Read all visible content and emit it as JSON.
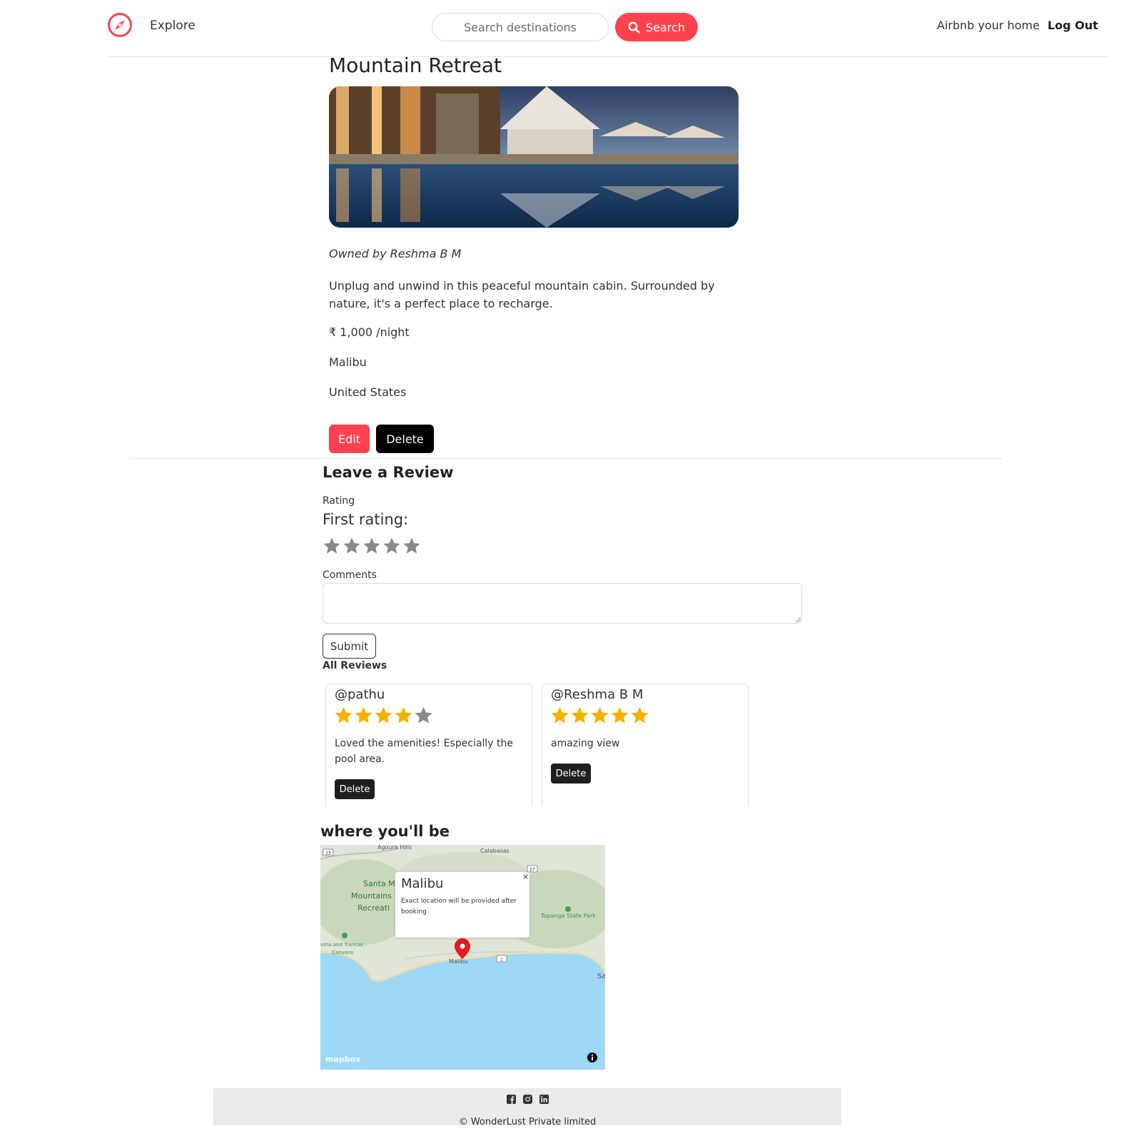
{
  "nav": {
    "explore_label": "Explore",
    "search_placeholder": "Search destinations",
    "search_button": "Search",
    "airbnb_label": "Airbnb your home",
    "logout_label": "Log Out"
  },
  "listing": {
    "title": "Mountain Retreat",
    "owner": "Owned by Reshma B M",
    "description": "Unplug and unwind in this peaceful mountain cabin. Surrounded by nature, it's a perfect place to recharge.",
    "price": "₹ 1,000 /night",
    "location": "Malibu",
    "country": "United States",
    "edit_label": "Edit",
    "delete_label": "Delete"
  },
  "review_form": {
    "heading": "Leave a Review",
    "rating_label": "Rating",
    "first_rating_label": "First rating:",
    "star_count": 5,
    "comments_label": "Comments",
    "submit_label": "Submit"
  },
  "reviews": {
    "heading": "All Reviews",
    "items": [
      {
        "author": "@pathu",
        "rating": 4,
        "comment": "Loved the amenities! Especially the pool area.",
        "delete_label": "Delete"
      },
      {
        "author": "@Reshma B M",
        "rating": 5,
        "comment": "amazing view",
        "delete_label": "Delete"
      }
    ]
  },
  "map": {
    "heading": "where you'll be",
    "popup_title": "Malibu",
    "popup_text": "Exact location will be provided after booking",
    "popup_close": "×",
    "attribution": "mapbox",
    "labels": {
      "agoura": "Agoura Hills",
      "calabasas": "Calabasas",
      "santa1": "Santa M",
      "santa2": "Mountains",
      "santa3": "Recreati",
      "topanga": "Topanga State Park",
      "canyons1": "uma and Trancas",
      "canyons2": "Canyons",
      "malibu": "Malibu",
      "sa": "Sa",
      "hwy23": "23",
      "hwy27": "27",
      "hwy1": "1"
    }
  },
  "colors": {
    "accent": "#fe424d",
    "star_filled": "#f5b301",
    "star_empty": "#8a8a8a",
    "ocean": "#9dd8f7"
  },
  "footer": {
    "icons": [
      "facebook-icon",
      "instagram-icon",
      "linkedin-icon"
    ],
    "copyright": "© WonderLust Private limited"
  }
}
